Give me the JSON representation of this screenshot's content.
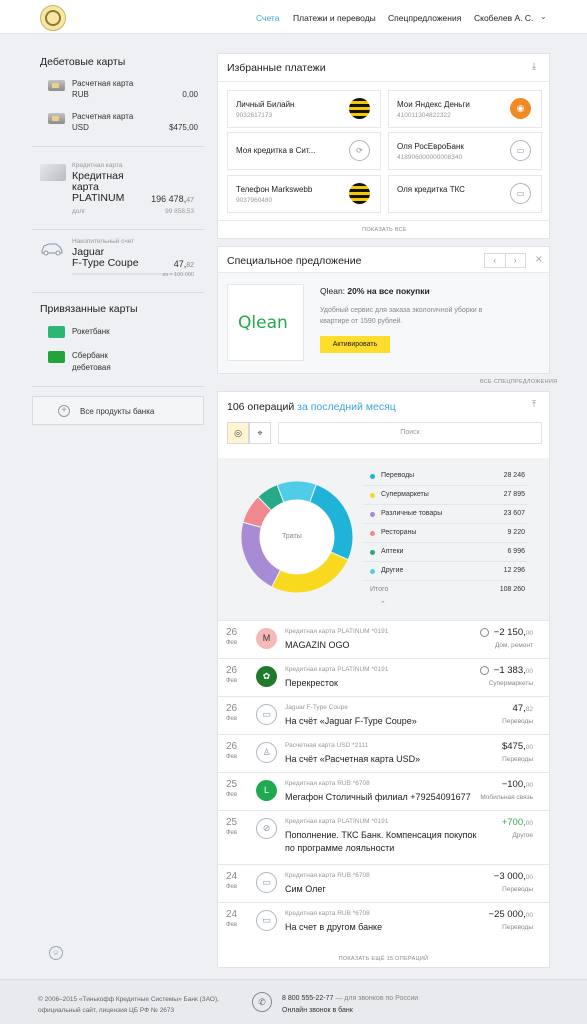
{
  "header": {
    "nav": [
      "Счета",
      "Платежи и переводы",
      "Спецпредложения"
    ],
    "user": "Скобелев А. С.",
    "chevron": "⌄"
  },
  "sidebar": {
    "debit_title": "Дебетовые карты",
    "debit_cards": [
      {
        "name": "Расчетная карта",
        "currency": "RUB",
        "amount": "0,00"
      },
      {
        "name": "Расчетная карта",
        "currency": "USD",
        "amount": "$475,00"
      }
    ],
    "credit": {
      "type": "Кредитная карта",
      "name_l1": "Кредитная",
      "name_l2": "карта",
      "name_l3": "PLATINUM",
      "amount": "196 478,",
      "amount_dec": "47",
      "debt_label": "долг",
      "debt": "99 858,53"
    },
    "savings": {
      "type": "Накопительный счет",
      "name_l1": "Jaguar",
      "name_l2": "F-Type Coupe",
      "amount": "47,",
      "amount_dec": "82",
      "goal": "из ≈ 100 000"
    },
    "linked_title": "Привязанные карты",
    "linked": [
      {
        "name": "Рокетбанк",
        "color": "#2bb673"
      },
      {
        "name_l1": "Сбербанк",
        "name_l2": "дебетовая",
        "color": "#22a43a"
      }
    ],
    "all_products": "Все продукты банка",
    "plus": "+",
    "smiley": "☺"
  },
  "favorites": {
    "title": "Избранные платежи",
    "upload": "⤓",
    "items": [
      {
        "name": "Личный Билайн",
        "num": "9032617173",
        "icon": "beeline"
      },
      {
        "name": "Мои Яндекс Деньги",
        "num": "410011304822322",
        "icon": "yandex",
        "glyph": "◉"
      },
      {
        "name": "Моя кредитка в Сит...",
        "num": "",
        "icon": "outline",
        "glyph": "⟳"
      },
      {
        "name": "Оля РосЕвроБанк",
        "num": "418906000000008340",
        "icon": "outline",
        "glyph": "▭"
      },
      {
        "name": "Телефон Markswebb",
        "num": "9037960480",
        "icon": "beeline"
      },
      {
        "name": "Оля кредитка ТКС",
        "num": "",
        "icon": "outline",
        "glyph": "▭"
      }
    ],
    "show_all": "ПОКАЗАТЬ ВСЕ"
  },
  "offer": {
    "title": "Специальное предложение",
    "logo": "Qlean",
    "headline_brand": "Qlean: ",
    "headline_rest": "20% на все покупки",
    "desc": "Удобный сервис для заказа экологичной уборки в квартире от 1590 рублей.",
    "button": "Активировать",
    "prev": "‹",
    "next": "›",
    "close": "✕",
    "all_offers": "ВСЕ СПЕЦПРЕДЛОЖЕНИЯ"
  },
  "operations": {
    "title_count": "106 операций ",
    "title_period": "за последний месяц",
    "upload": "⤒",
    "search_placeholder": "Поиск",
    "tool1": "◎",
    "tool2": "⌖",
    "donut_label": "Траты",
    "legend": [
      {
        "name": "Переводы",
        "value": "28 246",
        "color": "#1fb3d8"
      },
      {
        "name": "Супермаркеты",
        "value": "27 895",
        "color": "#f8d91e"
      },
      {
        "name": "Различные товары",
        "value": "23 607",
        "color": "#a78bd4"
      },
      {
        "name": "Рестораны",
        "value": "9 220",
        "color": "#f0898e"
      },
      {
        "name": "Аптеки",
        "value": "6 996",
        "color": "#26a88a"
      },
      {
        "name": "Другие",
        "value": "12 296",
        "color": "#4fcde8"
      }
    ],
    "total_label": "Итого",
    "total": "108 260",
    "collapse": "⌃",
    "rows": [
      {
        "day": "26",
        "mon": "Фев",
        "src": "Кредитная карта PLATINUM *0191",
        "desc": "MAGAZIN OGO",
        "amt": "−2 150,",
        "dec": "00",
        "cat": "Дом, ремонт",
        "icon_bg": "#f6b9b9",
        "icon_fg": "#333",
        "glyph": "M",
        "clock": true
      },
      {
        "day": "26",
        "mon": "Фев",
        "src": "Кредитная карта PLATINUM *0191",
        "desc": "Перекресток",
        "amt": "−1 383,",
        "dec": "00",
        "cat": "Супермаркеты",
        "icon_bg": "#1f7a2c",
        "icon_fg": "#fff",
        "glyph": "✿",
        "clock": true
      },
      {
        "day": "26",
        "mon": "Фев",
        "src": "Jaguar F-Type Coupe",
        "desc": "На счёт «Jaguar F-Type Coupe»",
        "amt": "47,",
        "dec": "82",
        "cat": "Переводы",
        "icon_bg": "#fff",
        "icon_fg": "#8a96a5",
        "glyph": "▭",
        "outline": true
      },
      {
        "day": "26",
        "mon": "Фев",
        "src": "Расчетная карта USD *2111",
        "desc": "На счёт «Расчетная карта USD»",
        "amt": "$475,",
        "dec": "00",
        "cat": "Переводы",
        "icon_bg": "#fff",
        "icon_fg": "#8a96a5",
        "glyph": "♙",
        "outline": true
      },
      {
        "day": "25",
        "mon": "Фев",
        "src": "Кредитная карта RUB *6708",
        "desc": "Мегафон Столичный филиал +79254091677",
        "amt": "−100,",
        "dec": "00",
        "cat": "Мобильная связь",
        "icon_bg": "#1faa52",
        "icon_fg": "#fff",
        "glyph": "L"
      },
      {
        "day": "25",
        "mon": "Фев",
        "src": "Кредитная карта PLATINUM *0191",
        "desc": "Пополнение. ТКС Банк. Компенсация покупок по программе лояльности",
        "amt": "+700,",
        "dec": "00",
        "cat": "Другое",
        "icon_bg": "#fff",
        "icon_fg": "#8a96a5",
        "glyph": "⊘",
        "outline": true,
        "green": true
      },
      {
        "day": "24",
        "mon": "Фев",
        "src": "Кредитная карта RUB *6708",
        "desc": "Сим Олег",
        "amt": "−3 000,",
        "dec": "00",
        "cat": "Переводы",
        "icon_bg": "#fff",
        "icon_fg": "#8a96a5",
        "glyph": "▭",
        "outline": true
      },
      {
        "day": "24",
        "mon": "Фев",
        "src": "Кредитная карта RUB *6708",
        "desc": "На счет в другом банке",
        "amt": "−25 000,",
        "dec": "00",
        "cat": "Переводы",
        "icon_bg": "#fff",
        "icon_fg": "#8a96a5",
        "glyph": "▭",
        "outline": true
      }
    ],
    "more": "ПОКАЗАТЬ ЕЩЁ 15 ОПЕРАЦИЙ"
  },
  "footer": {
    "line1": "© 2006–2015 «Тинькофф Кредитные Системы» Банк (ЗАО),",
    "line2": "официальный сайт, лицензия ЦБ РФ № 2673",
    "phone": "8 800 555-22-77",
    "phone_note": " — для звонков по России",
    "online": "Онлайн звонок в банк",
    "phone_glyph": "✆"
  }
}
